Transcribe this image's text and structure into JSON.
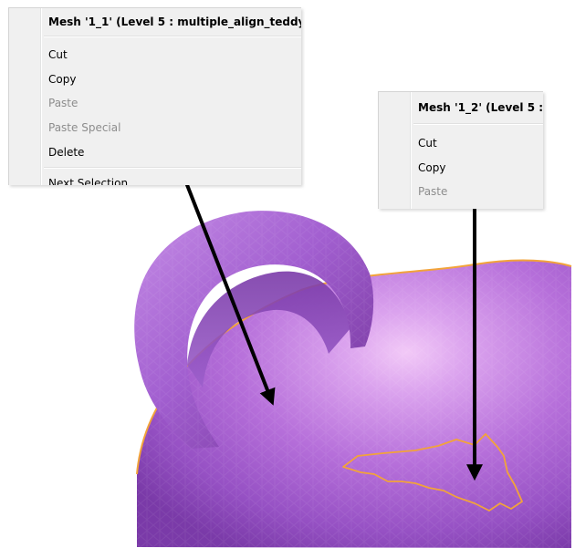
{
  "menu1": {
    "title": "Mesh '1_1' (Level 5 : multiple_align_teddy",
    "items": [
      {
        "label": "Cut",
        "enabled": true
      },
      {
        "label": "Copy",
        "enabled": true
      },
      {
        "label": "Paste",
        "enabled": false
      },
      {
        "label": "Paste Special",
        "enabled": false
      },
      {
        "label": "Delete",
        "enabled": true
      },
      {
        "label": "Next Selection",
        "enabled": true
      }
    ]
  },
  "menu2": {
    "title": "Mesh '1_2' (Level 5 :",
    "items": [
      {
        "label": "Cut",
        "enabled": true
      },
      {
        "label": "Copy",
        "enabled": true
      },
      {
        "label": "Paste",
        "enabled": false
      }
    ]
  },
  "colors": {
    "mesh_light": "#e7b3f2",
    "mesh_mid": "#b46ad6",
    "mesh_dark": "#6f2e96",
    "selection_outline": "#f2a33a",
    "arrow": "#000000",
    "menu_bg": "#f0f0f0",
    "disabled_text": "#8d8d8d"
  }
}
